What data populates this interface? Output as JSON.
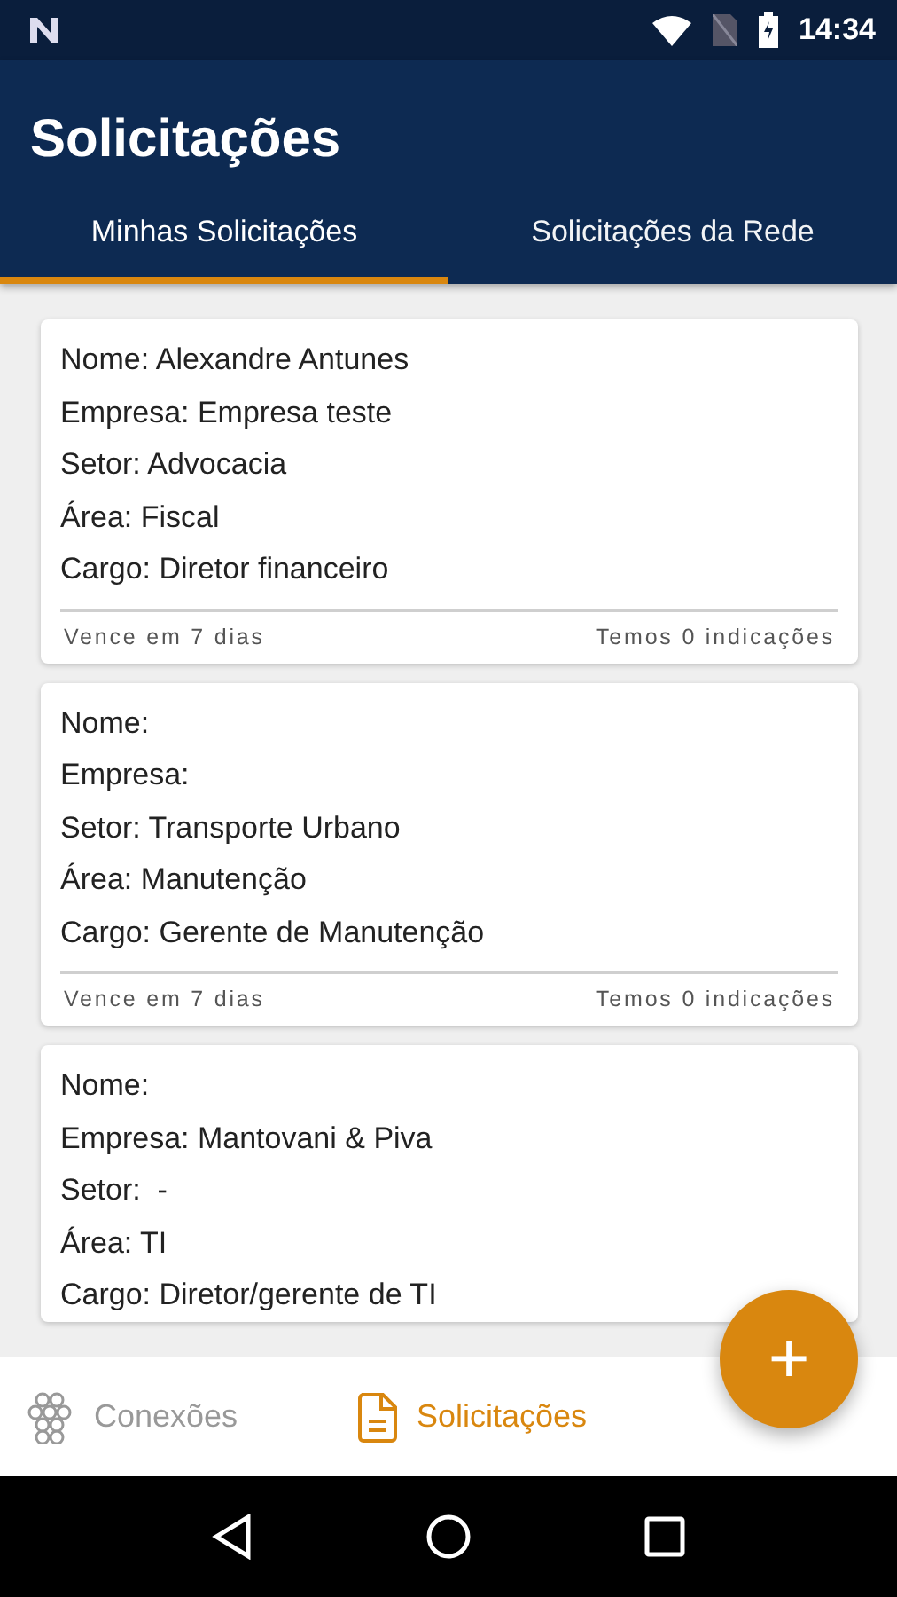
{
  "status_bar": {
    "time": "14:34"
  },
  "app_bar": {
    "title": "Solicitações"
  },
  "tabs": [
    {
      "label": "Minhas Solicitações",
      "selected": true
    },
    {
      "label": "Solicitações da Rede",
      "selected": false
    }
  ],
  "cards": [
    {
      "lines": [
        "Nome: Alexandre Antunes",
        "Empresa: Empresa teste",
        "Setor: Advocacia",
        "Área: Fiscal",
        "Cargo: Diretor financeiro"
      ],
      "footer_left": "Vence em 7 dias",
      "footer_right": "Temos 0 indicações"
    },
    {
      "lines": [
        "Nome:",
        "Empresa:",
        "Setor: Transporte Urbano",
        "Área: Manutenção",
        "Cargo: Gerente de Manutenção"
      ],
      "footer_left": "Vence em 7 dias",
      "footer_right": "Temos 0 indicações"
    },
    {
      "lines": [
        "Nome:",
        "Empresa: Mantovani & Piva",
        "Setor:  -",
        "Área: TI",
        "Cargo: Diretor/gerente de TI"
      ]
    }
  ],
  "fab": {
    "label": "+"
  },
  "bottom_nav": [
    {
      "kind": "connections",
      "label": "Conexões",
      "selected": false
    },
    {
      "kind": "requests",
      "label": "Solicitações",
      "selected": true
    }
  ]
}
